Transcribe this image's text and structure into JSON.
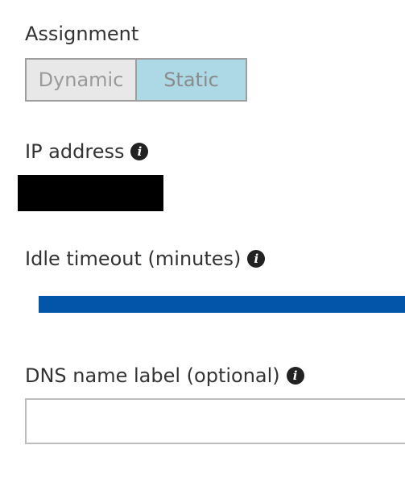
{
  "assignment": {
    "label": "Assignment",
    "options": [
      "Dynamic",
      "Static"
    ],
    "selected": "Static"
  },
  "ip_address": {
    "label": "IP address",
    "info_icon": "info-icon"
  },
  "idle_timeout": {
    "label": "Idle timeout (minutes)",
    "info_icon": "info-icon",
    "slider_color": "#0255a9"
  },
  "dns_name": {
    "label": "DNS name label (optional)",
    "info_icon": "info-icon",
    "value": "",
    "placeholder": ""
  },
  "colors": {
    "selected_toggle": "#add8e6",
    "unselected_toggle": "#e8e8e8",
    "border": "#9e9e9e"
  }
}
